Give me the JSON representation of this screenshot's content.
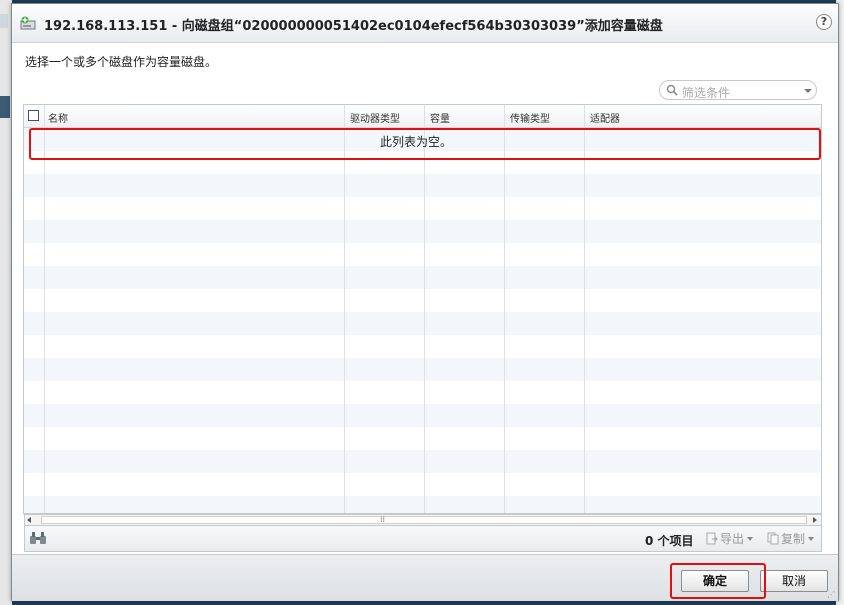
{
  "dialog": {
    "title": "192.168.113.151 - 向磁盘组“020000000051402ec0104efecf564b30303039”添加容量磁盘",
    "help_label": "?",
    "instruction": "选择一个或多个磁盘作为容量磁盘。"
  },
  "filter": {
    "placeholder": "筛选条件",
    "icon": "search-icon"
  },
  "table": {
    "columns": [
      "名称",
      "驱动器类型",
      "容量",
      "传输类型",
      "适配器"
    ],
    "rows": [],
    "empty_message": "此列表为空。"
  },
  "footer": {
    "item_count": "0 个项目",
    "export_label": "导出",
    "copy_label": "复制"
  },
  "buttons": {
    "ok_label": "确定",
    "cancel_label": "取消"
  },
  "colors": {
    "highlight": "#e01010",
    "checkbox_border": "#3d4b8a"
  }
}
